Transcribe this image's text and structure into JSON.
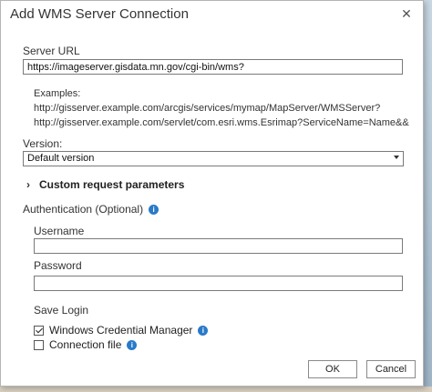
{
  "window": {
    "title": "Add WMS Server Connection",
    "close_glyph": "✕"
  },
  "server_url": {
    "label": "Server URL",
    "value": "https://imageserver.gisdata.mn.gov/cgi-bin/wms?"
  },
  "examples": {
    "label": "Examples:",
    "items": [
      "http://gisserver.example.com/arcgis/services/mymap/MapServer/WMSServer?",
      "http://gisserver.example.com/servlet/com.esri.wms.Esrimap?ServiceName=Name&&"
    ]
  },
  "version": {
    "label": "Version:",
    "selected": "Default version"
  },
  "custom_params": {
    "label": "Custom request parameters"
  },
  "authentication": {
    "label": "Authentication (Optional)",
    "username_label": "Username",
    "username_value": "",
    "password_label": "Password",
    "password_value": "",
    "save_login_label": "Save Login",
    "options": [
      {
        "label": "Windows Credential Manager",
        "checked": true
      },
      {
        "label": "Connection file",
        "checked": false
      }
    ]
  },
  "buttons": {
    "ok": "OK",
    "cancel": "Cancel"
  },
  "icons": {
    "info": "info-icon",
    "info_glyph": "i",
    "chevron": "›"
  },
  "colors": {
    "info_blue": "#2a7ac8"
  }
}
